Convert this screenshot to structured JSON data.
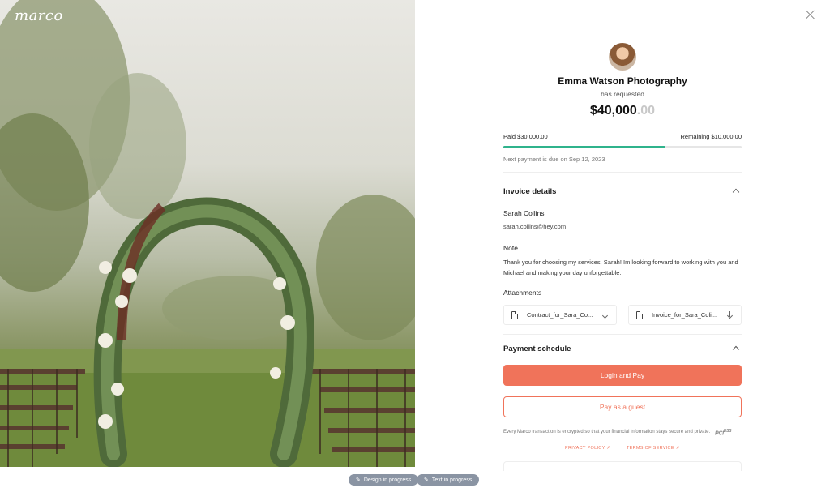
{
  "brand": {
    "logo": "marco"
  },
  "footer_pills": [
    {
      "label": "Design in progress",
      "icon": "pencil-icon"
    },
    {
      "label": "Text in progress",
      "icon": "pencil-icon"
    }
  ],
  "request": {
    "business_name": "Emma Watson Photography",
    "subtitle": "has requested",
    "amount_main": "$40,000",
    "amount_cents": ".00",
    "paid_label": "Paid $30,000.00",
    "remaining_label": "Remaining $10,000.00",
    "progress_fraction": 0.68,
    "next_payment": "Next payment is due on Sep 12, 2023"
  },
  "invoice_details": {
    "title": "Invoice details",
    "client_name": "Sarah Collins",
    "client_email": "sarah.collins@hey.com",
    "note_label": "Note",
    "note_text": "Thank you for choosing my services, Sarah! Im looking forward to working with you and Michael and making your day unforgettable.",
    "attachments_label": "Attachments",
    "attachments": [
      {
        "name": "Contract_for_Sara_Co..."
      },
      {
        "name": "Invoice_for_Sara_Coli..."
      }
    ]
  },
  "payment_schedule": {
    "title": "Payment schedule",
    "login_pay": "Login and Pay",
    "guest_pay": "Pay as a guest",
    "security_note": "Every Marco transaction is encrypted so that your financial information stays secure and private.",
    "pci_text": "PCI",
    "pci_dss": "DSS",
    "privacy_policy": "PRIVACY POLICY ↗",
    "terms": "TERMS OF SERVICE ↗"
  },
  "colors": {
    "accent": "#f0735a",
    "progress": "#2fb38c"
  }
}
